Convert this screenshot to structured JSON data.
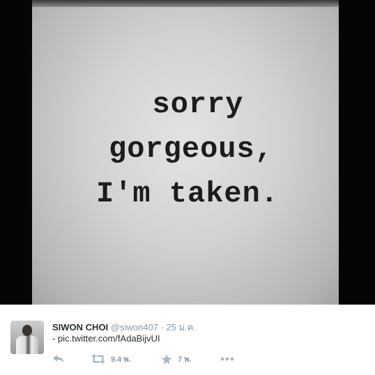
{
  "media": {
    "lines": [
      "sorry",
      "gorgeous,",
      "I'm taken."
    ]
  },
  "tweet": {
    "name": "SIWON CHOI",
    "handle": "@siwon407",
    "separator": "·",
    "date": "25 ม.ค.",
    "text_prefix": "- ",
    "link": "pic.twitter.com/fAdaBijvUI",
    "actions": {
      "reply_icon": "reply-icon",
      "retweet_icon": "retweet-icon",
      "retweet_count": "9.4 พ.",
      "favorite_icon": "star-icon",
      "favorite_count": "7 พ.",
      "more_icon": "more-dots-icon"
    }
  },
  "colors": {
    "name": "#292f33",
    "secondary": "#8899a6",
    "icon": "#aab8c2",
    "media_bg": "#050505"
  }
}
